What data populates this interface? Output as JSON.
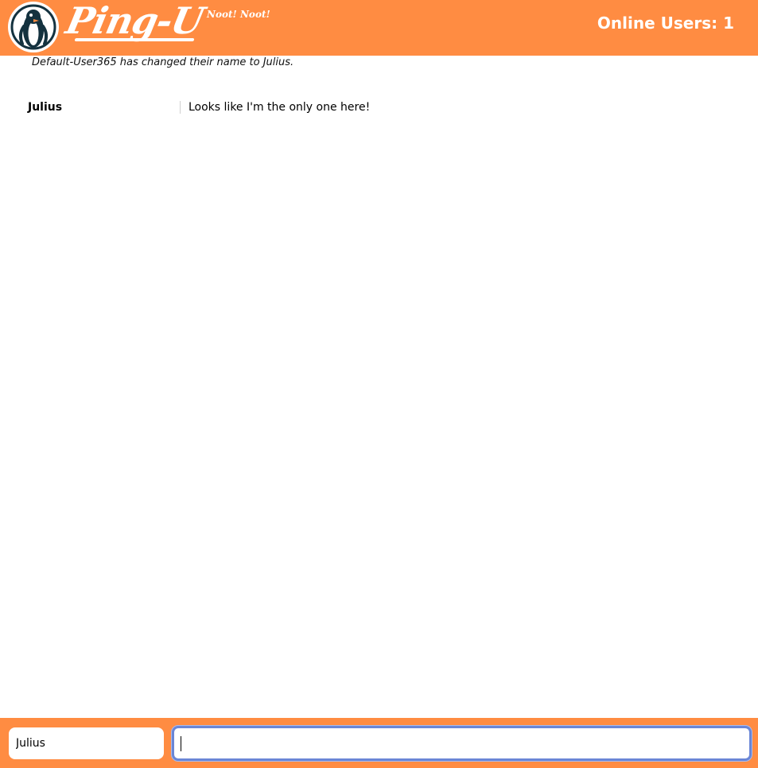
{
  "header": {
    "brand": "Ping-U",
    "tagline": "Noot! Noot!",
    "online_users": "Online Users: 1"
  },
  "messages": {
    "system": "Default-User365 has changed their name to Julius.",
    "chat": [
      {
        "user": "Julius",
        "text": "Looks like I'm the only one here!"
      }
    ]
  },
  "footer": {
    "name_value": "Julius",
    "message_value": ""
  },
  "colors": {
    "header_bg": "#ff8c42",
    "logo_navy": "#14323f"
  },
  "icons": {
    "logo": "penguin-icon"
  }
}
